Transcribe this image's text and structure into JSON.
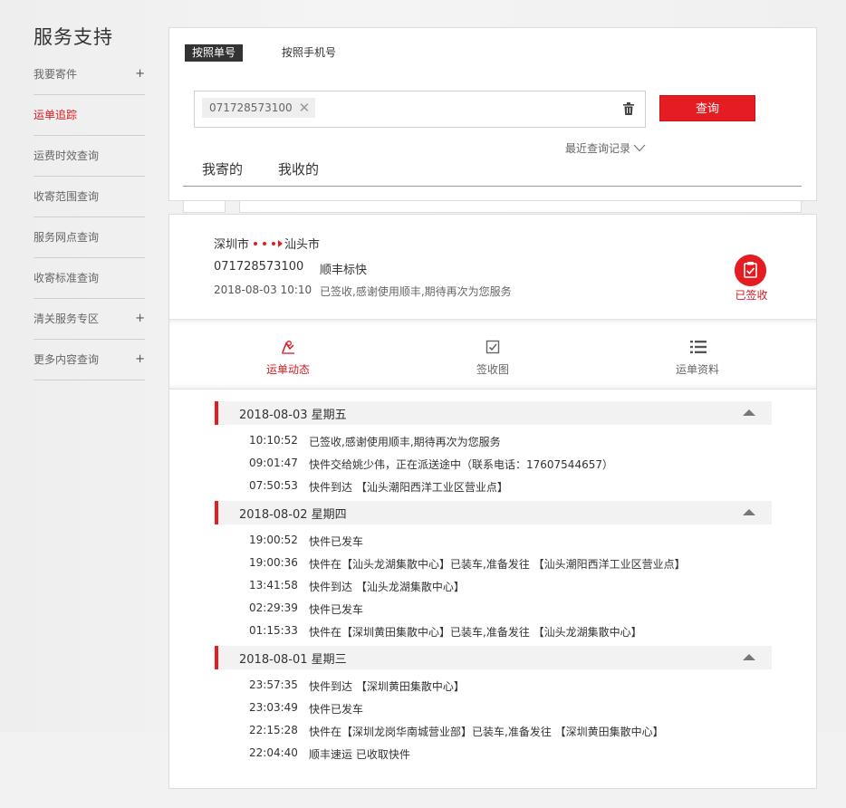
{
  "sidebar": {
    "title": "服务支持",
    "items": [
      {
        "label": "我要寄件",
        "plus": "+"
      },
      {
        "label": "运单追踪",
        "plus": ""
      },
      {
        "label": "运费时效查询",
        "plus": ""
      },
      {
        "label": "收寄范围查询",
        "plus": ""
      },
      {
        "label": "服务网点查询",
        "plus": ""
      },
      {
        "label": "收寄标准查询",
        "plus": ""
      },
      {
        "label": "清关服务专区",
        "plus": "+"
      },
      {
        "label": "更多内容查询",
        "plus": "+"
      }
    ]
  },
  "query": {
    "tab_by_no": "按照单号",
    "tab_by_phone": "按照手机号",
    "chip_value": "071728573100",
    "chip_close": "✕",
    "query_button": "查询",
    "recent": "最近查询记录",
    "tab_sent": "我寄的",
    "tab_received": "我收的"
  },
  "summary": {
    "from": "深圳市",
    "to": "汕头市",
    "waybill": "071728573100",
    "product": "顺丰标快",
    "last_time": "2018-08-03 10:10",
    "last_status": "已签收,感谢使用顺丰,期待再次为您服务",
    "signed_label": "已签收"
  },
  "sub_tabs": {
    "tracking": "运单动态",
    "signature": "签收图",
    "info": "运单资料"
  },
  "days": [
    {
      "date": "2018-08-03 星期五",
      "events": [
        {
          "time": "10:10:52",
          "desc": "已签收,感谢使用顺丰,期待再次为您服务"
        },
        {
          "time": "09:01:47",
          "desc": "快件交给姚少伟，正在派送途中（联系电话：17607544657）"
        },
        {
          "time": "07:50:53",
          "desc": "快件到达 【汕头潮阳西洋工业区营业点】"
        }
      ]
    },
    {
      "date": "2018-08-02 星期四",
      "events": [
        {
          "time": "19:00:52",
          "desc": "快件已发车"
        },
        {
          "time": "19:00:36",
          "desc": "快件在【汕头龙湖集散中心】已装车,准备发往 【汕头潮阳西洋工业区营业点】"
        },
        {
          "time": "13:41:58",
          "desc": "快件到达 【汕头龙湖集散中心】"
        },
        {
          "time": "02:29:39",
          "desc": "快件已发车"
        },
        {
          "time": "01:15:33",
          "desc": "快件在【深圳黄田集散中心】已装车,准备发往 【汕头龙湖集散中心】"
        }
      ]
    },
    {
      "date": "2018-08-01 星期三",
      "events": [
        {
          "time": "23:57:35",
          "desc": "快件到达 【深圳黄田集散中心】"
        },
        {
          "time": "23:03:49",
          "desc": "快件已发车"
        },
        {
          "time": "22:15:28",
          "desc": "快件在【深圳龙岗华南城营业部】已装车,准备发往 【深圳黄田集散中心】"
        },
        {
          "time": "22:04:40",
          "desc": "顺丰速运 已收取快件"
        }
      ]
    }
  ],
  "colors": {
    "accent": "#e51c22",
    "active_text": "#d71920",
    "dark_tab": "#333333"
  }
}
